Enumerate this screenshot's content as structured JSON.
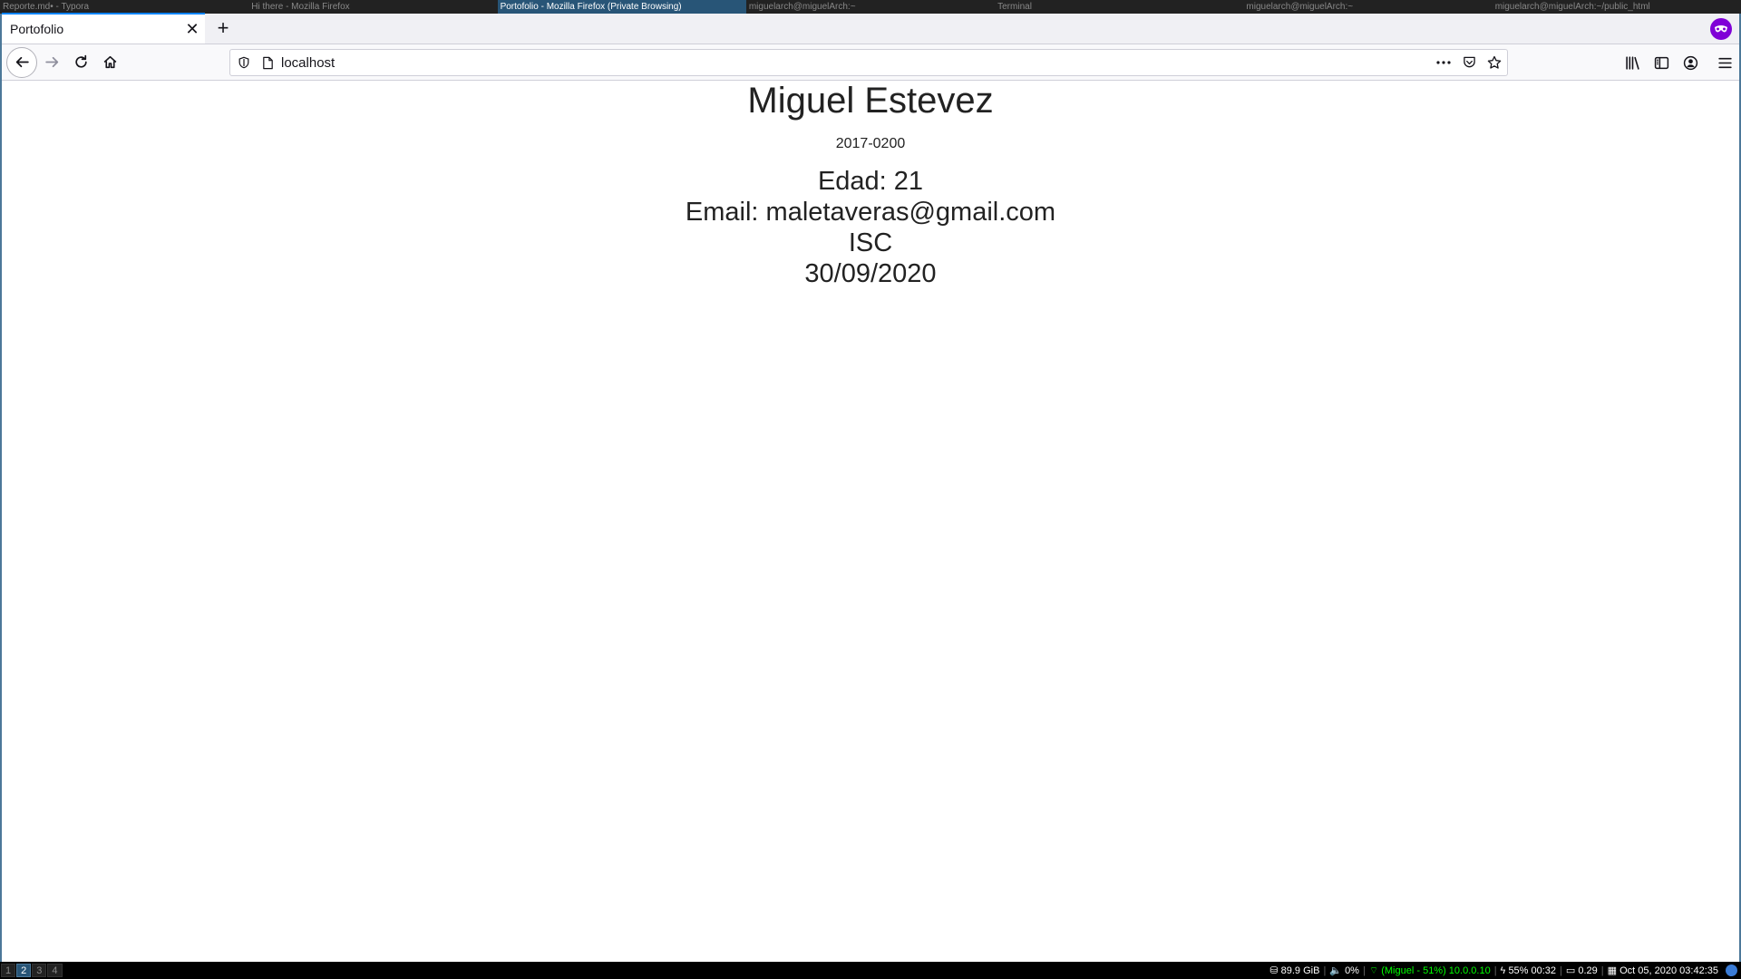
{
  "wm": {
    "windows": [
      {
        "title": "Reporte.md• - Typora",
        "active": false
      },
      {
        "title": "Hi there - Mozilla Firefox",
        "active": false
      },
      {
        "title": "Portofolio - Mozilla Firefox (Private Browsing)",
        "active": true
      },
      {
        "title": "miguelarch@miguelArch:~",
        "active": false
      },
      {
        "title": "Terminal",
        "active": false
      },
      {
        "title": "miguelarch@miguelArch:~",
        "active": false
      },
      {
        "title": "miguelarch@miguelArch:~/public_html",
        "active": false
      }
    ]
  },
  "browser": {
    "tab_title": "Portofolio",
    "tab_close": "✕",
    "new_tab": "+",
    "url": "localhost",
    "accent": "#0a84ff",
    "private_color": "#8000d7"
  },
  "page": {
    "name": "Miguel Estevez",
    "id": "2017-0200",
    "age": "Edad: 21",
    "email": "Email: maletaveras@gmail.com",
    "career": "ISC",
    "date": "30/09/2020"
  },
  "statusbar": {
    "workspaces": [
      "1",
      "2",
      "3",
      "4"
    ],
    "focused_workspace": "2",
    "disk": "89.9 GiB",
    "volume": "0%",
    "wifi": "(Miguel -  51%) 10.0.0.10",
    "battery": "55% 00:32",
    "load": "0.29",
    "datetime": "Oct 05, 2020 03:42:35"
  }
}
